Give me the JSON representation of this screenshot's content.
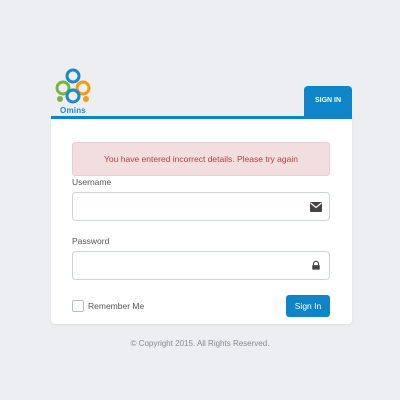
{
  "logo": {
    "text": "Omins"
  },
  "tab": {
    "label": "SIGN IN"
  },
  "alert": {
    "message": "You have entered incorrect details. Please try again"
  },
  "username": {
    "label": "Username",
    "value": "",
    "placeholder": "",
    "icon": "envelope-icon"
  },
  "password": {
    "label": "Password",
    "value": "",
    "placeholder": "",
    "icon": "lock-icon"
  },
  "remember": {
    "label": "Remember Me",
    "checked": false
  },
  "signin_button": {
    "label": "Sign In"
  },
  "footer": {
    "copyright": "© Copyright 2015. All Rights Reserved."
  },
  "colors": {
    "accent": "#0e85c8",
    "alert_bg": "#f2dede",
    "alert_text": "#a94442",
    "background": "#eceef1"
  }
}
